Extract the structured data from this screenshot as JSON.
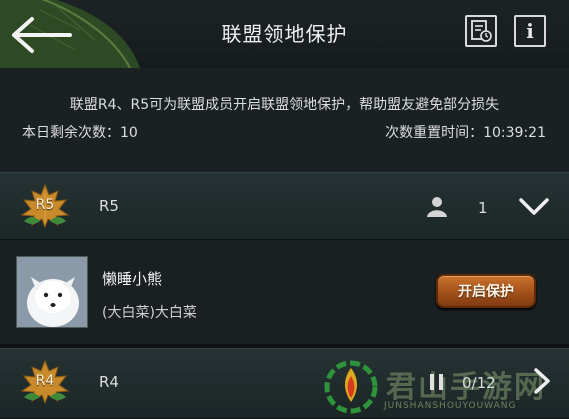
{
  "header": {
    "title": "联盟领地保护",
    "back_icon": "arrow-left-icon",
    "log_icon": "log-clock-icon",
    "info_icon": "info-icon",
    "info_label": "i"
  },
  "info": {
    "description": "联盟R4、R5可为联盟成员开启联盟领地保护，帮助盟友避免部分损失",
    "remaining_label": "本日剩余次数：10",
    "reset_label": "次数重置时间：10:39:21"
  },
  "ranks": [
    {
      "badge": "R5",
      "name": "R5",
      "member_count": "1",
      "expanded": true,
      "members": [
        {
          "name": "懒睡小熊",
          "alliance": "(大白菜)大白菜",
          "action_label": "开启保护"
        }
      ]
    },
    {
      "badge": "R4",
      "name": "R4",
      "member_count": "0/12"
    }
  ],
  "watermark": {
    "text": "君山手游网",
    "sub": "JUNSHANSHOUYOUWANG"
  },
  "colors": {
    "background": "#151a1b",
    "row": "#263233",
    "button": "#a4511a",
    "badge": "#d99a30"
  }
}
